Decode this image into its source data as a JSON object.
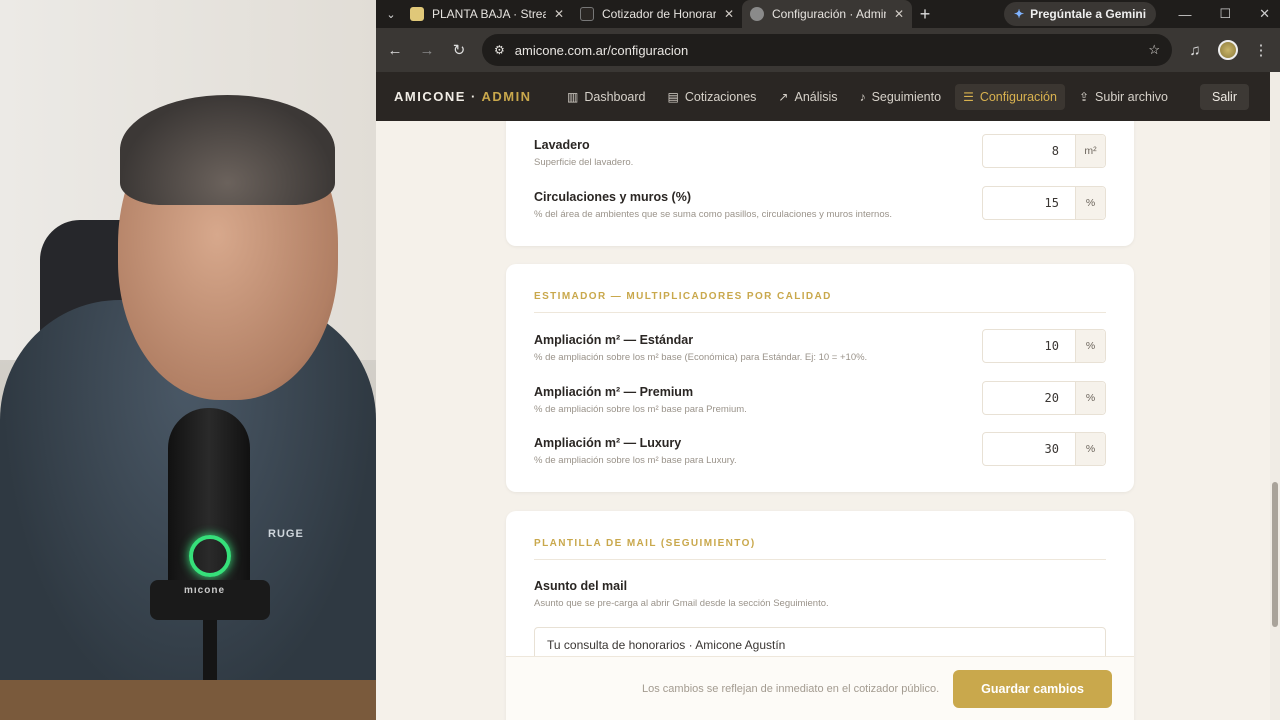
{
  "camera": {
    "mic_brand": "mıcone",
    "shirt_logo": "RUGE"
  },
  "browser": {
    "tabs": [
      {
        "title": "PLANTA BAJA · Streaming",
        "favicon_color": "#e0c879",
        "active": false
      },
      {
        "title": "Cotizador de Honorarios",
        "favicon_color": "#2a2623",
        "active": false
      },
      {
        "title": "Configuración · Admin",
        "favicon_color": "#8a8a8a",
        "active": true
      }
    ],
    "new_tab": "+",
    "gemini_label": "Pregúntale a Gemini",
    "url": "amicone.com.ar/configuracion"
  },
  "app": {
    "brand_main": "AMICONE · ",
    "brand_accent": "ADMIN",
    "nav": [
      {
        "label": "Dashboard",
        "icon": "chart-bar-icon",
        "active": false
      },
      {
        "label": "Cotizaciones",
        "icon": "document-icon",
        "active": false
      },
      {
        "label": "Análisis",
        "icon": "line-chart-icon",
        "active": false
      },
      {
        "label": "Seguimiento",
        "icon": "bell-icon",
        "active": false
      },
      {
        "label": "Configuración",
        "icon": "sliders-icon",
        "active": true
      },
      {
        "label": "Subir archivo",
        "icon": "upload-icon",
        "active": false
      }
    ],
    "logout": "Salir"
  },
  "areas_card": {
    "rows": [
      {
        "label": "Lavadero",
        "desc": "Superficie del lavadero.",
        "value": "8",
        "unit": "m²"
      },
      {
        "label": "Circulaciones y muros (%)",
        "desc": "% del área de ambientes que se suma como pasillos, circulaciones y muros internos.",
        "value": "15",
        "unit": "%"
      }
    ]
  },
  "estimador": {
    "heading": "ESTIMADOR — MULTIPLICADORES POR CALIDAD",
    "rows": [
      {
        "label": "Ampliación m² — Estándar",
        "desc": "% de ampliación sobre los m² base (Económica) para Estándar. Ej: 10 = +10%.",
        "value": "10",
        "unit": "%"
      },
      {
        "label": "Ampliación m² — Premium",
        "desc": "% de ampliación sobre los m² base para Premium.",
        "value": "20",
        "unit": "%"
      },
      {
        "label": "Ampliación m² — Luxury",
        "desc": "% de ampliación sobre los m² base para Luxury.",
        "value": "30",
        "unit": "%"
      }
    ]
  },
  "mail": {
    "heading": "PLANTILLA DE MAIL (SEGUIMIENTO)",
    "subject_label": "Asunto del mail",
    "subject_desc": "Asunto que se pre-carga al abrir Gmail desde la sección Seguimiento.",
    "subject_value": "Tu consulta de honorarios · Amicone Agustín"
  },
  "savebar": {
    "note": "Los cambios se reflejan de inmediato en el cotizador público.",
    "button": "Guardar cambios"
  },
  "colors": {
    "accent": "#c9a84c",
    "nav_bg": "#2a2623",
    "page_bg": "#f5f1ea"
  }
}
